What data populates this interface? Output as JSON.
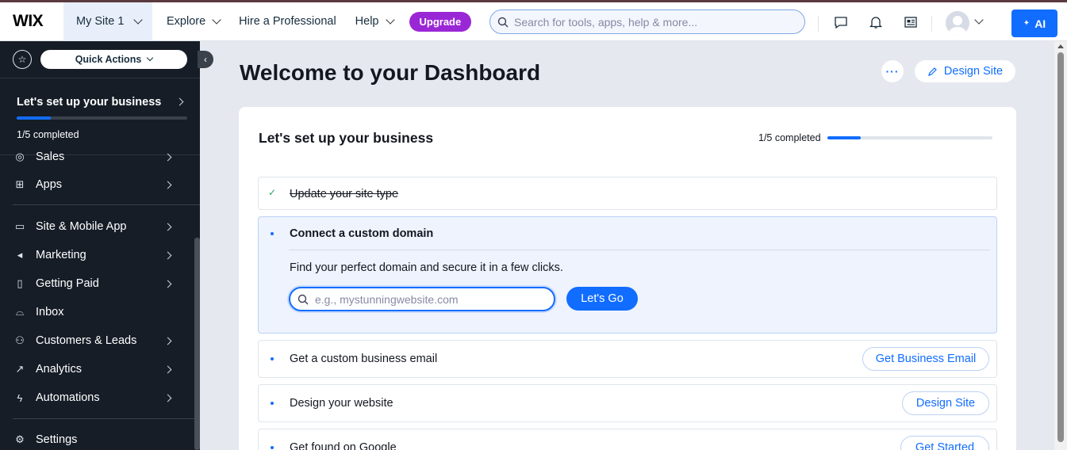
{
  "topbar": {
    "logo": "WIX",
    "site_selector": "My Site 1",
    "nav": [
      {
        "label": "Explore"
      },
      {
        "label": "Hire a Professional"
      },
      {
        "label": "Help"
      }
    ],
    "upgrade": "Upgrade",
    "search_placeholder": "Search for tools, apps, help & more...",
    "ai_label": "AI",
    "icons": [
      "chat-icon",
      "bell-icon",
      "news-icon",
      "avatar",
      "chevron-down-icon"
    ]
  },
  "sidebar": {
    "quick_actions": "Quick Actions",
    "setup": {
      "title": "Let's set up your business",
      "progress_text": "1/5 completed",
      "progress_fraction": 0.2
    },
    "items": [
      {
        "label": "Sales",
        "icon": "sales-icon",
        "has_arrow": true
      },
      {
        "label": "Apps",
        "icon": "apps-icon",
        "has_arrow": true
      },
      {
        "label": "Site & Mobile App",
        "icon": "site-icon",
        "has_arrow": true
      },
      {
        "label": "Marketing",
        "icon": "megaphone-icon",
        "has_arrow": true
      },
      {
        "label": "Getting Paid",
        "icon": "payment-icon",
        "has_arrow": true
      },
      {
        "label": "Inbox",
        "icon": "inbox-icon",
        "has_arrow": false
      },
      {
        "label": "Customers & Leads",
        "icon": "customers-icon",
        "has_arrow": true
      },
      {
        "label": "Analytics",
        "icon": "analytics-icon",
        "has_arrow": true
      },
      {
        "label": "Automations",
        "icon": "automations-icon",
        "has_arrow": true
      },
      {
        "label": "Settings",
        "icon": "gear-icon",
        "has_arrow": false
      }
    ]
  },
  "main": {
    "title": "Welcome to your Dashboard",
    "more_label": "···",
    "design_site": "Design Site",
    "card": {
      "title": "Let's set up your business",
      "progress_text": "1/5 completed",
      "progress_fraction": 0.2,
      "steps": [
        {
          "label": "Update your site type",
          "status": "done"
        },
        {
          "label": "Connect a custom domain",
          "status": "active",
          "description": "Find your perfect domain and secure it in a few clicks.",
          "input_placeholder": "e.g., mystunningwebsite.com",
          "button": "Let's Go"
        },
        {
          "label": "Get a custom business email",
          "action": "Get Business Email"
        },
        {
          "label": "Design your website",
          "action": "Design Site"
        },
        {
          "label": "Get found on Google",
          "action": "Get Started"
        }
      ]
    }
  },
  "colors": {
    "accent": "#116dff",
    "upgrade": "#9a27d5",
    "sidebar_bg": "#161d27",
    "page_bg": "#e5e8ef",
    "done_check": "#25a55f"
  }
}
